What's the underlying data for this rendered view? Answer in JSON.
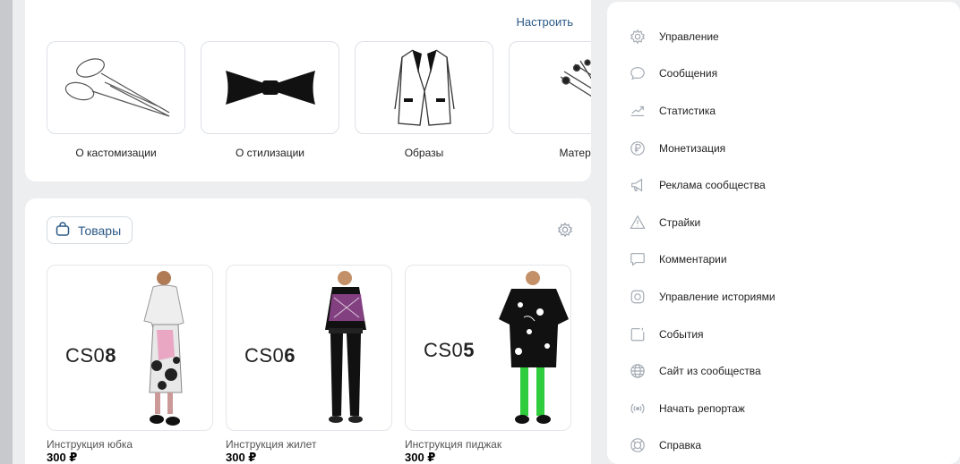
{
  "customization": {
    "configure_label": "Настроить",
    "tiles": [
      {
        "label": "О кастомизации",
        "icon": "scissors-icon"
      },
      {
        "label": "О стилизации",
        "icon": "bowtie-icon"
      },
      {
        "label": "Образы",
        "icon": "jacket-icon"
      },
      {
        "label": "Матери",
        "icon": "pins-icon"
      }
    ]
  },
  "market": {
    "chip_label": "Товары",
    "products": [
      {
        "code_prefix": "CS0",
        "code_digit": "8",
        "title": "Инструкция юбка",
        "price": "300 ₽"
      },
      {
        "code_prefix": "CS0",
        "code_digit": "6",
        "title": "Инструкция жилет",
        "price": "300 ₽"
      },
      {
        "code_prefix": "CS0",
        "code_digit": "5",
        "title": "Инструкция пиджак",
        "price": "300 ₽"
      }
    ]
  },
  "menu": {
    "items": [
      {
        "label": "Управление",
        "icon": "gear-icon"
      },
      {
        "label": "Сообщения",
        "icon": "message-icon"
      },
      {
        "label": "Статистика",
        "icon": "stats-icon"
      },
      {
        "label": "Монетизация",
        "icon": "ruble-icon"
      },
      {
        "label": "Реклама сообщества",
        "icon": "megaphone-icon"
      },
      {
        "label": "Страйки",
        "icon": "warning-icon"
      },
      {
        "label": "Комментарии",
        "icon": "comment-icon"
      },
      {
        "label": "Управление историями",
        "icon": "stories-icon"
      },
      {
        "label": "События",
        "icon": "events-icon"
      },
      {
        "label": "Сайт из сообщества",
        "icon": "globe-icon"
      },
      {
        "label": "Начать репортаж",
        "icon": "broadcast-icon"
      },
      {
        "label": "Справка",
        "icon": "help-icon"
      }
    ]
  }
}
